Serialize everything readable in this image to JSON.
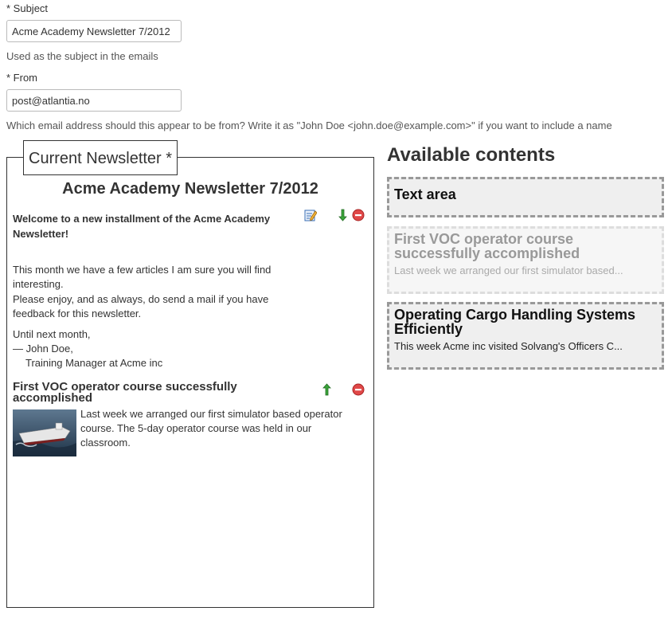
{
  "subject": {
    "label": "* Subject",
    "value": "Acme Academy Newsletter 7/2012",
    "help": "Used as the subject in the emails"
  },
  "from": {
    "label": "* From",
    "value": "post@atlantia.no",
    "help": "Which email address should this appear to be from? Write it as \"John Doe <john.doe@example.com>\" if you want to include a name"
  },
  "newsletter": {
    "legend": "Current Newsletter *",
    "title": "Acme Academy Newsletter 7/2012",
    "intro": {
      "heading": "Welcome to a new installment of the Acme Academy Newsletter!",
      "line1": "This month we have a few articles I am sure you will find interesting.",
      "line2": "Please enjoy, and as always, do send a mail if you have feedback for this newsletter.",
      "signoff1": "Until next month,",
      "signoff2": "— John Doe,",
      "signoff3": "Training Manager at Acme inc"
    },
    "article": {
      "title": "First VOC operator course successfully accomplished",
      "body": "Last week we arranged our first simulator based operator course. The 5-day operator course was held in our classroom."
    }
  },
  "available": {
    "heading": "Available contents",
    "items": [
      {
        "title": "Text area",
        "subtitle": ""
      },
      {
        "title": "First VOC operator course successfully accomplished",
        "subtitle": "Last week we arranged our first simulator based..."
      },
      {
        "title": "Operating Cargo Handling Systems Efficiently",
        "subtitle": "This week Acme inc visited Solvang's Officers C..."
      }
    ]
  },
  "colors": {
    "edit_icon": "#3b6fb6",
    "arrow_icon": "#2e9a2e",
    "remove_icon": "#d9393a"
  },
  "icons": [
    "edit-icon",
    "arrow-down-icon",
    "arrow-up-icon",
    "remove-icon"
  ]
}
